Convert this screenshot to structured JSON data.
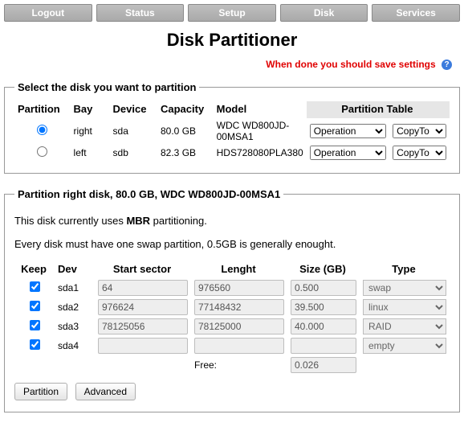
{
  "nav": [
    "Logout",
    "Status",
    "Setup",
    "Disk",
    "Services"
  ],
  "title": "Disk Partitioner",
  "warning": "When done you should save settings",
  "selectLegend": "Select the disk you want to partition",
  "diskHdr": {
    "part": "Partition",
    "bay": "Bay",
    "dev": "Device",
    "cap": "Capacity",
    "model": "Model",
    "ptbl": "Partition Table"
  },
  "disks": [
    {
      "sel": true,
      "bay": "right",
      "dev": "sda",
      "cap": "80.0 GB",
      "model": "WDC WD800JD-00MSA1",
      "op": "Operation",
      "copy": "CopyTo"
    },
    {
      "sel": false,
      "bay": "left",
      "dev": "sdb",
      "cap": "82.3 GB",
      "model": "HDS728080PLA380",
      "op": "Operation",
      "copy": "CopyTo"
    }
  ],
  "detailLegend": "Partition right disk, 80.0 GB, WDC WD800JD-00MSA1",
  "note1a": "This disk currently uses ",
  "note1b": "MBR",
  "note1c": " partitioning.",
  "note2": "Every disk must have one swap partition, 0.5GB is generally enought.",
  "partHdr": {
    "keep": "Keep",
    "dev": "Dev",
    "start": "Start sector",
    "len": "Lenght",
    "size": "Size (GB)",
    "type": "Type"
  },
  "parts": [
    {
      "keep": true,
      "dev": "sda1",
      "start": "64",
      "len": "976560",
      "size": "0.500",
      "type": "swap"
    },
    {
      "keep": true,
      "dev": "sda2",
      "start": "976624",
      "len": "77148432",
      "size": "39.500",
      "type": "linux"
    },
    {
      "keep": true,
      "dev": "sda3",
      "start": "78125056",
      "len": "78125000",
      "size": "40.000",
      "type": "RAID"
    },
    {
      "keep": true,
      "dev": "sda4",
      "start": "",
      "len": "",
      "size": "",
      "type": "empty"
    }
  ],
  "freeLabel": "Free:",
  "freeValue": "0.026",
  "buttons": {
    "part": "Partition",
    "adv": "Advanced"
  }
}
